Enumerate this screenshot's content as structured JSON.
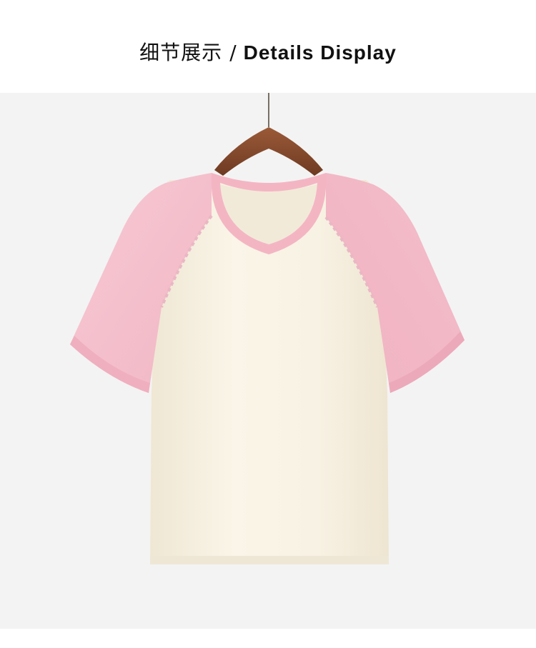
{
  "header": {
    "title_cn": "细节展示",
    "separator": "/",
    "title_en": "Details Display"
  },
  "colors": {
    "background": "#ffffff",
    "photo_background": "#f3f3f3",
    "body_fabric": "#f7f1e3",
    "sleeve_fabric": "#f5bfcc",
    "hanger": "#8a4a2c"
  }
}
